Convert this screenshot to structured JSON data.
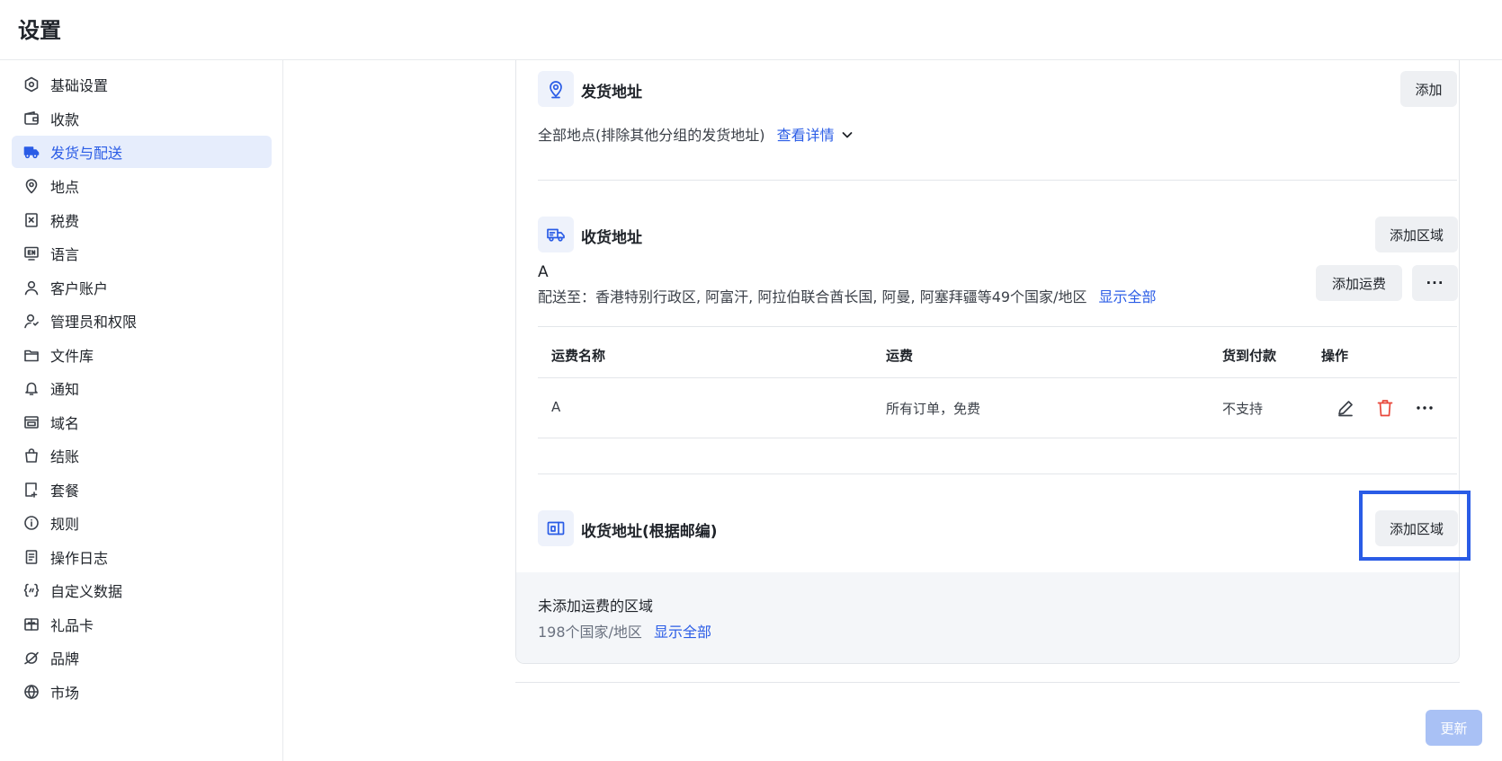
{
  "header": {
    "title": "设置"
  },
  "sidebar": {
    "items": [
      {
        "label": "基础设置",
        "icon": "gear-icon"
      },
      {
        "label": "收款",
        "icon": "wallet-icon"
      },
      {
        "label": "发货与配送",
        "icon": "truck-icon",
        "active": true
      },
      {
        "label": "地点",
        "icon": "location-pin-icon"
      },
      {
        "label": "税费",
        "icon": "receipt-icon"
      },
      {
        "label": "语言",
        "icon": "language-icon"
      },
      {
        "label": "客户账户",
        "icon": "user-icon"
      },
      {
        "label": "管理员和权限",
        "icon": "user-shield-icon"
      },
      {
        "label": "文件库",
        "icon": "folder-icon"
      },
      {
        "label": "通知",
        "icon": "bell-icon"
      },
      {
        "label": "域名",
        "icon": "domain-icon"
      },
      {
        "label": "结账",
        "icon": "shopping-bag-icon"
      },
      {
        "label": "套餐",
        "icon": "plan-icon"
      },
      {
        "label": "规则",
        "icon": "info-icon"
      },
      {
        "label": "操作日志",
        "icon": "log-icon"
      },
      {
        "label": "自定义数据",
        "icon": "custom-data-icon"
      },
      {
        "label": "礼品卡",
        "icon": "gift-card-icon"
      },
      {
        "label": "品牌",
        "icon": "brand-icon"
      },
      {
        "label": "市场",
        "icon": "globe-icon"
      }
    ]
  },
  "shipping_origin": {
    "title": "发货地址",
    "add_label": "添加",
    "description": "全部地点(排除其他分组的发货地址)",
    "details_link": "查看详情"
  },
  "delivery_zones": {
    "title": "收货地址",
    "add_zone_label": "添加区域",
    "zone": {
      "name": "A",
      "ship_to": "配送至：香港特别行政区, 阿富汗, 阿拉伯联合酋长国, 阿曼, 阿塞拜疆等49个国家/地区",
      "show_all": "显示全部",
      "add_rate_label": "添加运费",
      "more_label": "···"
    },
    "table": {
      "headers": [
        "运费名称",
        "运费",
        "货到付款",
        "操作"
      ],
      "rows": [
        {
          "name": "A",
          "rate": "所有订单，免费",
          "cod": "不支持"
        }
      ]
    }
  },
  "postcode_zones": {
    "title": "收货地址(根据邮编)",
    "add_zone_label": "添加区域"
  },
  "unassigned": {
    "title": "未添加运费的区域",
    "count_text": "198个国家/地区",
    "show_all": "显示全部"
  },
  "footer": {
    "update_label": "更新"
  },
  "colors": {
    "accent": "#2a5ce6",
    "danger": "#e8473b",
    "highlight": "#2a5ce6"
  }
}
